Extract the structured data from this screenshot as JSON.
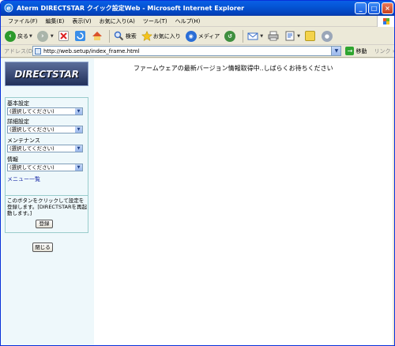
{
  "window": {
    "title": "Aterm DIRECTSTAR クイック設定Web - Microsoft Internet Explorer",
    "buttons": [
      "minimize",
      "maximize",
      "close"
    ]
  },
  "menubar": {
    "items": [
      {
        "label": "ファイル(F)"
      },
      {
        "label": "編集(E)"
      },
      {
        "label": "表示(V)"
      },
      {
        "label": "お気に入り(A)"
      },
      {
        "label": "ツール(T)"
      },
      {
        "label": "ヘルプ(H)"
      }
    ]
  },
  "toolbar": {
    "back_label": "戻る",
    "search_label": "検索",
    "favorites_label": "お気に入り",
    "media_label": "メディア"
  },
  "address": {
    "label": "アドレス(D)",
    "url": "http://web.setup/index_frame.html",
    "go_label": "移動",
    "links_label": "リンク »"
  },
  "sidebar": {
    "logo_text": "DIRECTSTAR",
    "groups": [
      {
        "label": "基本設定",
        "selected": "(選択してください)"
      },
      {
        "label": "詳細設定",
        "selected": "(選択してください)"
      },
      {
        "label": "メンテナンス",
        "selected": "(選択してください)"
      },
      {
        "label": "情報",
        "selected": "(選択してください)"
      }
    ],
    "menu_list_link": "メニュー一覧",
    "note_text": "このボタンをクリックして設定を登録します。[DIRECTSTARを再起動します。]",
    "register_button": "登録",
    "close_button": "閉じる"
  },
  "main": {
    "message": "ファームウェアの最新バージョン情報取得中..しばらくお待ちください"
  },
  "colors": {
    "titlebar": "#0454d4",
    "chrome": "#ece9d8",
    "sidebar_bg": "#eef8fb",
    "link": "#2233aa"
  }
}
